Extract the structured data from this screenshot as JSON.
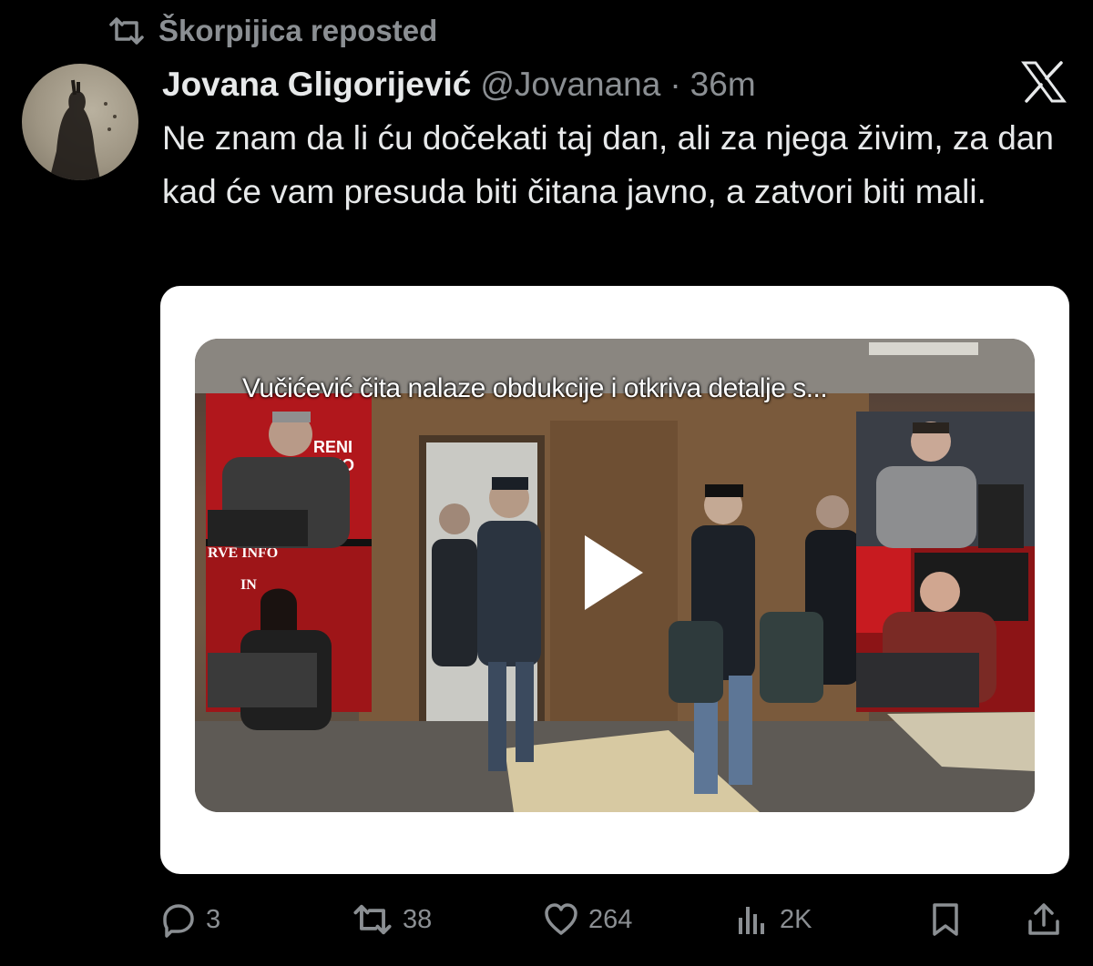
{
  "repost": {
    "icon": "repost-icon",
    "text": "Škorpijica reposted"
  },
  "tweet": {
    "author_name": "Jovana Gligorijević",
    "author_handle": "@Jovanana",
    "separator": "·",
    "time": "36m",
    "text": "Ne znam da li ću dočekati taj dan, ali za njega živim, za dan kad će vam presuda biti čitana javno, a zatvori biti mali.",
    "avatar_icon": "avatar-silhouette"
  },
  "media": {
    "caption": "Vučićević čita nalaze obdukcije i otkriva detalje s...",
    "play_icon": "play-icon",
    "studio_signs": [
      "RENI",
      "UDIO",
      "RVE INFO",
      "IN"
    ]
  },
  "actions": {
    "replies": "3",
    "reposts": "38",
    "likes": "264",
    "views": "2K"
  },
  "colors": {
    "background": "#000000",
    "text": "#e7e9ea",
    "muted": "#8b8f93",
    "card": "#ffffff"
  }
}
